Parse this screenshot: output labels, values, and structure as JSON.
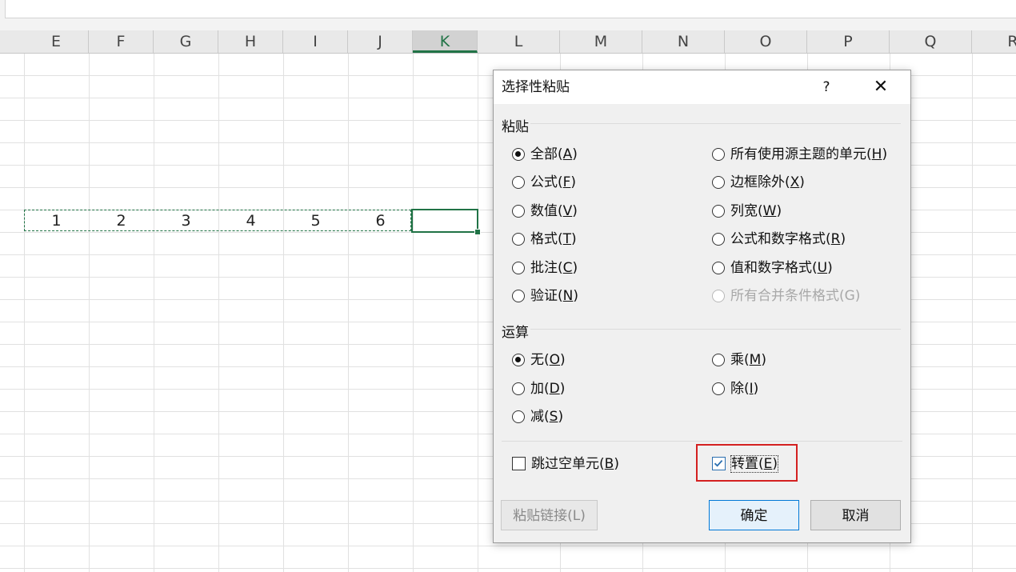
{
  "sheet": {
    "columns": [
      "E",
      "F",
      "G",
      "H",
      "I",
      "J",
      "K",
      "L",
      "M",
      "N",
      "O",
      "P",
      "Q",
      "R"
    ],
    "active_column": "K",
    "row_values": [
      "1",
      "2",
      "3",
      "4",
      "5",
      "6"
    ]
  },
  "dialog": {
    "title": "选择性粘贴",
    "help_label": "?",
    "close_label": "✕",
    "paste_group": {
      "label": "粘贴",
      "options": [
        {
          "text": "全部(",
          "key": "A",
          "tail": ")",
          "checked": true,
          "disabled": false
        },
        {
          "text": "公式(",
          "key": "F",
          "tail": ")",
          "checked": false,
          "disabled": false
        },
        {
          "text": "数值(",
          "key": "V",
          "tail": ")",
          "checked": false,
          "disabled": false
        },
        {
          "text": "格式(",
          "key": "T",
          "tail": ")",
          "checked": false,
          "disabled": false
        },
        {
          "text": "批注(",
          "key": "C",
          "tail": ")",
          "checked": false,
          "disabled": false
        },
        {
          "text": "验证(",
          "key": "N",
          "tail": ")",
          "checked": false,
          "disabled": false
        },
        {
          "text": "所有使用源主题的单元(",
          "key": "H",
          "tail": ")",
          "checked": false,
          "disabled": false
        },
        {
          "text": "边框除外(",
          "key": "X",
          "tail": ")",
          "checked": false,
          "disabled": false
        },
        {
          "text": "列宽(",
          "key": "W",
          "tail": ")",
          "checked": false,
          "disabled": false
        },
        {
          "text": "公式和数字格式(",
          "key": "R",
          "tail": ")",
          "checked": false,
          "disabled": false
        },
        {
          "text": "值和数字格式(",
          "key": "U",
          "tail": ")",
          "checked": false,
          "disabled": false
        },
        {
          "text": "所有合并条件格式(G)",
          "key": "",
          "tail": "",
          "checked": false,
          "disabled": true
        }
      ]
    },
    "operation_group": {
      "label": "运算",
      "options": [
        {
          "text": "无(",
          "key": "O",
          "tail": ")",
          "checked": true
        },
        {
          "text": "加(",
          "key": "D",
          "tail": ")",
          "checked": false
        },
        {
          "text": "减(",
          "key": "S",
          "tail": ")",
          "checked": false
        },
        {
          "text": "乘(",
          "key": "M",
          "tail": ")",
          "checked": false
        },
        {
          "text": "除(",
          "key": "I",
          "tail": ")",
          "checked": false
        }
      ]
    },
    "skip_blanks": {
      "text": "跳过空单元(",
      "key": "B",
      "tail": ")",
      "checked": false
    },
    "transpose": {
      "text": "转置(",
      "key": "E",
      "tail": ")",
      "checked": true
    },
    "buttons": {
      "paste_link": "粘贴链接(L)",
      "ok": "确定",
      "cancel": "取消"
    }
  },
  "colors": {
    "excel_green": "#217346",
    "highlight_red": "#d42020",
    "primary_button_border": "#0078d7"
  }
}
